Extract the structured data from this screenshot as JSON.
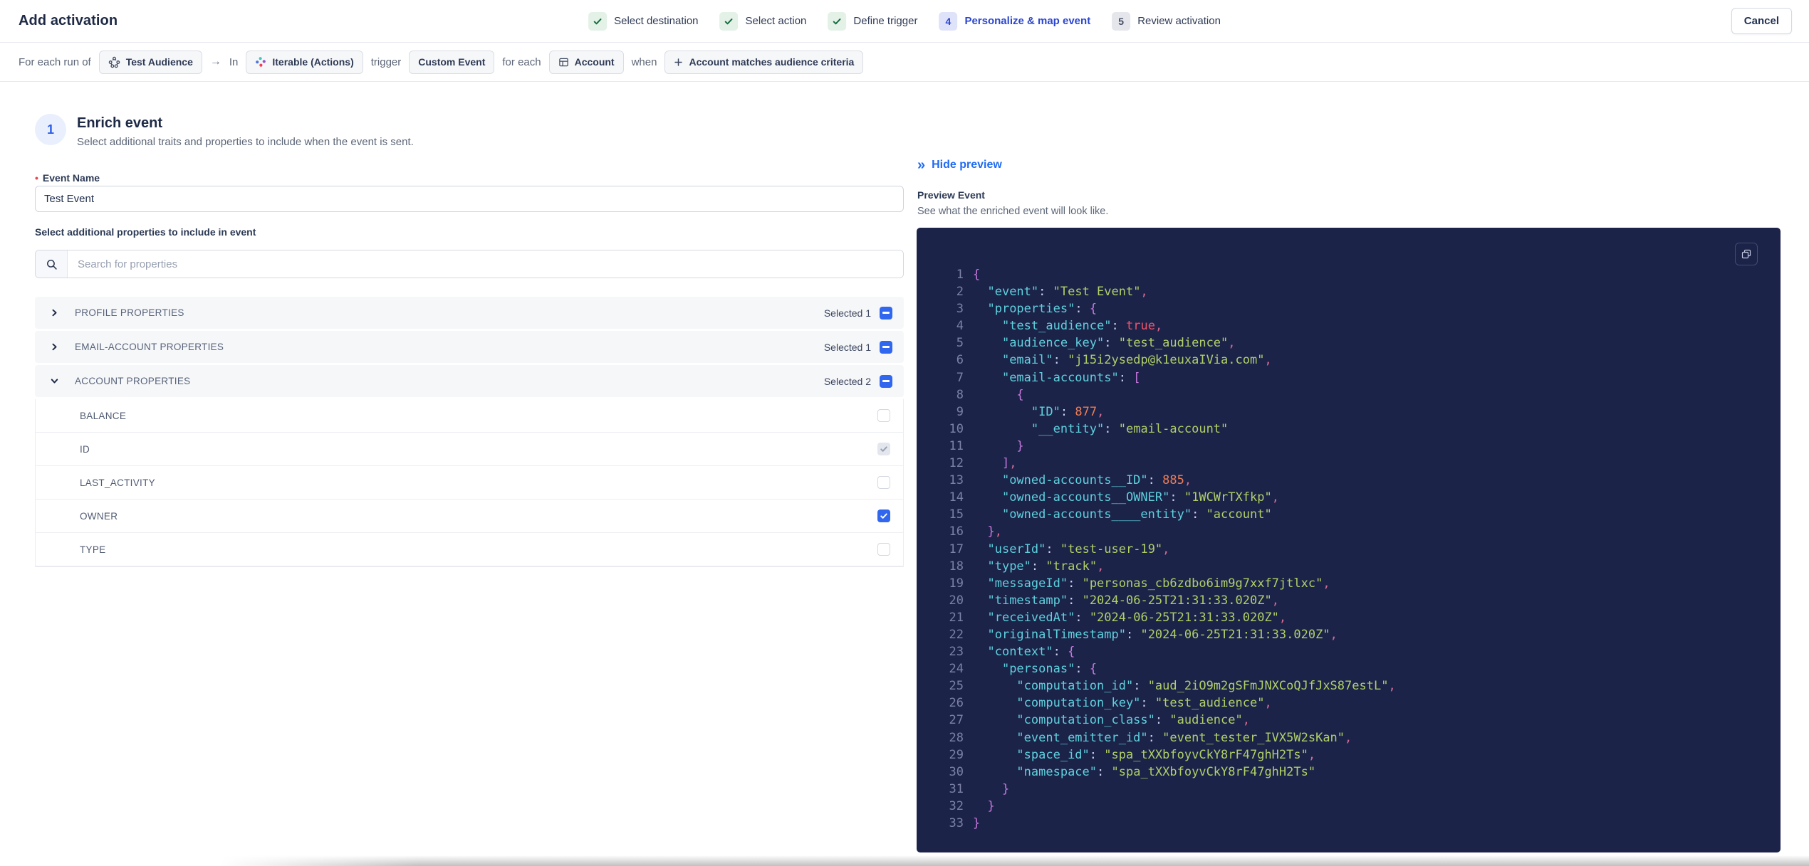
{
  "colors": {
    "accent_blue": "#2d5fe8",
    "stepper_active_blue": "#2b46cf",
    "link_blue": "#1f6bf1",
    "checkbox_blue": "#3166ef",
    "success_green": "#156e3e",
    "code_background": "#1c2349",
    "code_key": "#5fd0dd",
    "code_string": "#b1cf68",
    "code_number": "#ed7d55",
    "code_boolean": "#f0536b"
  },
  "icons": {
    "stepper_done": "check-icon",
    "audience_chip": "audience-icon",
    "destination_chip": "iterable-logo-icon",
    "entity_chip": "table-icon",
    "criteria_chip": "plus-icon",
    "search": "search-icon",
    "collapse_preview": "double-chevron-right-icon",
    "copy": "copy-icon",
    "group_collapsed": "chevron-right-icon",
    "group_expanded": "chevron-down-icon"
  },
  "header": {
    "title": "Add activation",
    "cancel_label": "Cancel",
    "steps": [
      {
        "label": "Select destination",
        "state": "done"
      },
      {
        "label": "Select action",
        "state": "done"
      },
      {
        "label": "Define trigger",
        "state": "done"
      },
      {
        "label": "Personalize & map event",
        "state": "active",
        "number": "4"
      },
      {
        "label": "Review activation",
        "state": "todo",
        "number": "5"
      }
    ]
  },
  "trigger_bar": {
    "segments": [
      {
        "kind": "text",
        "text": "For each run of"
      },
      {
        "kind": "chip",
        "icon": "audience-icon",
        "text": "Test Audience"
      },
      {
        "kind": "arrow",
        "text": "→"
      },
      {
        "kind": "text",
        "text": "In"
      },
      {
        "kind": "chip",
        "icon": "iterable-logo-icon",
        "text": "Iterable (Actions)"
      },
      {
        "kind": "text",
        "text": "trigger"
      },
      {
        "kind": "chip",
        "text": "Custom Event"
      },
      {
        "kind": "text",
        "text": "for each"
      },
      {
        "kind": "chip",
        "icon": "table-icon",
        "text": "Account"
      },
      {
        "kind": "text",
        "text": "when"
      },
      {
        "kind": "chip",
        "icon": "plus-icon",
        "text": "Account matches audience criteria"
      }
    ]
  },
  "enrich": {
    "step_number": "1",
    "title": "Enrich event",
    "subtitle": "Select additional traits and properties to include when the event is sent.",
    "event_name_label": "Event Name",
    "event_name_value": "Test Event",
    "properties_label": "Select additional properties to include in event",
    "search_placeholder": "Search for properties",
    "groups": [
      {
        "label": "PROFILE PROPERTIES",
        "selected_text": "Selected 1",
        "expanded": false,
        "items": []
      },
      {
        "label": "EMAIL-ACCOUNT PROPERTIES",
        "selected_text": "Selected 1",
        "expanded": false,
        "items": []
      },
      {
        "label": "ACCOUNT PROPERTIES",
        "selected_text": "Selected 2",
        "expanded": true,
        "items": [
          {
            "label": "BALANCE",
            "checked": false,
            "disabled": false
          },
          {
            "label": "ID",
            "checked": true,
            "disabled": true
          },
          {
            "label": "LAST_ACTIVITY",
            "checked": false,
            "disabled": false
          },
          {
            "label": "OWNER",
            "checked": true,
            "disabled": false
          },
          {
            "label": "TYPE",
            "checked": false,
            "disabled": false
          }
        ]
      }
    ]
  },
  "preview": {
    "hide_label": "Hide preview",
    "title": "Preview Event",
    "subtitle": "See what the enriched event will look like.",
    "code_lines": [
      "{",
      "  \"event\": \"Test Event\",",
      "  \"properties\": {",
      "    \"test_audience\": true,",
      "    \"audience_key\": \"test_audience\",",
      "    \"email\": \"j15i2ysedp@k1euxaIVia.com\",",
      "    \"email-accounts\": [",
      "      {",
      "        \"ID\": 877,",
      "        \"__entity\": \"email-account\"",
      "      }",
      "    ],",
      "    \"owned-accounts__ID\": 885,",
      "    \"owned-accounts__OWNER\": \"1WCWrTXfkp\",",
      "    \"owned-accounts____entity\": \"account\"",
      "  },",
      "  \"userId\": \"test-user-19\",",
      "  \"type\": \"track\",",
      "  \"messageId\": \"personas_cb6zdbo6im9g7xxf7jtlxc\",",
      "  \"timestamp\": \"2024-06-25T21:31:33.020Z\",",
      "  \"receivedAt\": \"2024-06-25T21:31:33.020Z\",",
      "  \"originalTimestamp\": \"2024-06-25T21:31:33.020Z\",",
      "  \"context\": {",
      "    \"personas\": {",
      "      \"computation_id\": \"aud_2iO9m2gSFmJNXCoQJfJxS87estL\",",
      "      \"computation_key\": \"test_audience\",",
      "      \"computation_class\": \"audience\",",
      "      \"event_emitter_id\": \"event_tester_IVX5W2sKan\",",
      "      \"space_id\": \"spa_tXXbfoyvCkY8rF47ghH2Ts\",",
      "      \"namespace\": \"spa_tXXbfoyvCkY8rF47ghH2Ts\"",
      "    }",
      "  }",
      "}"
    ]
  }
}
